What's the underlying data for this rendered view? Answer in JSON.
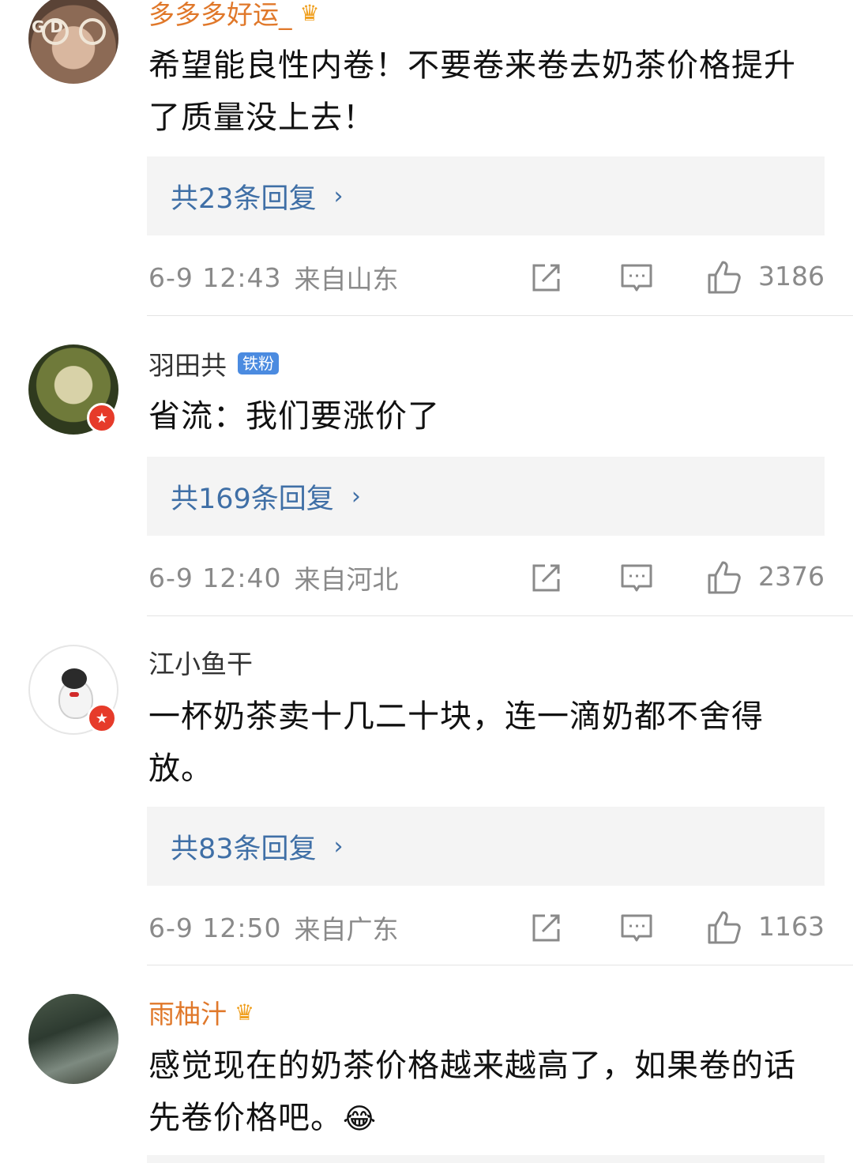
{
  "comments": [
    {
      "username": "多多多好运_",
      "name_color": "#e0782a",
      "has_crown": true,
      "text": "希望能良性内卷！不要卷来卷去奶茶价格提升了质量没上去！",
      "reply_label": "共23条回复",
      "date": "6-9 12:43",
      "location": "来自山东",
      "likes": "3186",
      "avatar_text": "G D"
    },
    {
      "username": "羽田共",
      "name_color": "#333333",
      "badge": "铁粉",
      "verified": true,
      "text": "省流：我们要涨价了",
      "reply_label": "共169条回复",
      "date": "6-9 12:40",
      "location": "来自河北",
      "likes": "2376"
    },
    {
      "username": "江小鱼干",
      "name_color": "#333333",
      "verified": true,
      "text": "一杯奶茶卖十几二十块，连一滴奶都不舍得放。",
      "reply_label": "共83条回复",
      "date": "6-9 12:50",
      "location": "来自广东",
      "likes": "1163"
    },
    {
      "username": "雨柚汁",
      "name_color": "#e0782a",
      "has_crown": true,
      "text": "感觉现在的奶茶价格越来越高了，如果卷的话先卷价格吧。",
      "emoji": "😂"
    }
  ],
  "icons": {
    "share": "share-icon",
    "comment": "comment-icon",
    "like": "thumbs-up-icon",
    "crown": "crown-icon",
    "verified": "verified-star-icon"
  },
  "colors": {
    "reply_link": "#3f6fa6",
    "reply_bg": "#f4f4f4",
    "meta": "#8a8a8a",
    "verified_badge": "#e63b2a",
    "fan_badge": "#4b8be0"
  },
  "glyphs": {
    "chevron": "›",
    "crown": "♛",
    "star": "★"
  }
}
